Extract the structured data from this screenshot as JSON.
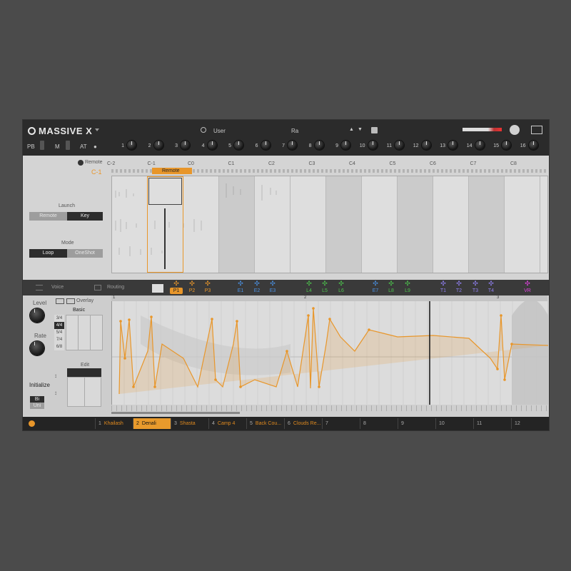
{
  "header": {
    "title": "MASSIVE X",
    "bank": "User",
    "preset": "Ra",
    "pb_label": "PB",
    "m_label": "M",
    "at_label": "AT",
    "macros": [
      "1",
      "2",
      "3",
      "4",
      "5",
      "6",
      "7",
      "8",
      "9",
      "10",
      "11",
      "12",
      "13",
      "14",
      "15",
      "16"
    ]
  },
  "remote": {
    "toggle_label": "Remote",
    "root_note": "C-1",
    "launch_label": "Launch",
    "launch_options": [
      "Remote",
      "Key"
    ],
    "launch_selected": "Key",
    "mode_label": "Mode",
    "mode_options": [
      "Loop",
      "OneShot"
    ],
    "mode_selected": "Loop",
    "tag_label": "Remote",
    "notes": [
      "C-2",
      "C-1",
      "C0",
      "C1",
      "C2",
      "C3",
      "C4",
      "C5",
      "C6",
      "C7",
      "C8"
    ]
  },
  "tabs": {
    "voice": "Voice",
    "routing": "Routing"
  },
  "mod_slots": [
    {
      "name": "P1",
      "color": "#e8962a",
      "active": true
    },
    {
      "name": "P2",
      "color": "#e8962a"
    },
    {
      "name": "P3",
      "color": "#e8962a"
    },
    {
      "name": "E1",
      "color": "#4a90e2"
    },
    {
      "name": "E2",
      "color": "#4a90e2"
    },
    {
      "name": "E3",
      "color": "#4a90e2"
    },
    {
      "name": "L4",
      "color": "#4cc24c"
    },
    {
      "name": "L5",
      "color": "#4cc24c"
    },
    {
      "name": "L6",
      "color": "#4cc24c"
    },
    {
      "name": "E7",
      "color": "#4a90e2"
    },
    {
      "name": "L8",
      "color": "#4cc24c"
    },
    {
      "name": "L9",
      "color": "#4cc24c"
    },
    {
      "name": "T1",
      "color": "#8f7ff0"
    },
    {
      "name": "T2",
      "color": "#8f7ff0"
    },
    {
      "name": "T3",
      "color": "#8f7ff0"
    },
    {
      "name": "T4",
      "color": "#8f7ff0"
    },
    {
      "name": "VR",
      "color": "#e040e0"
    }
  ],
  "performer": {
    "level_label": "Level",
    "rate_label": "Rate",
    "overlay_label": "Overlay",
    "basic_label": "Basic",
    "edit_label": "Edit",
    "initialize_label": "Initialize",
    "bi_label": "Bi",
    "uni_label": "Uni",
    "time_sigs": [
      "3/4",
      "4/4",
      "5/4",
      "7/4",
      "6/8"
    ],
    "ruler_marks": [
      "1",
      "2",
      "3"
    ]
  },
  "snapshots": [
    {
      "num": "1",
      "name": "Khailash"
    },
    {
      "num": "2",
      "name": "Denali",
      "selected": true
    },
    {
      "num": "3",
      "name": "Shasta"
    },
    {
      "num": "4",
      "name": "Camp 4"
    },
    {
      "num": "5",
      "name": "Back Cou..."
    },
    {
      "num": "6",
      "name": "Clouds Re..."
    },
    {
      "num": "7",
      "name": ""
    },
    {
      "num": "8",
      "name": ""
    },
    {
      "num": "9",
      "name": ""
    },
    {
      "num": "10",
      "name": ""
    },
    {
      "num": "11",
      "name": ""
    },
    {
      "num": "12",
      "name": ""
    }
  ],
  "colors": {
    "accent": "#e8962a",
    "header_bg": "#2b2b2b",
    "panel_bg": "#d4d4d4"
  }
}
